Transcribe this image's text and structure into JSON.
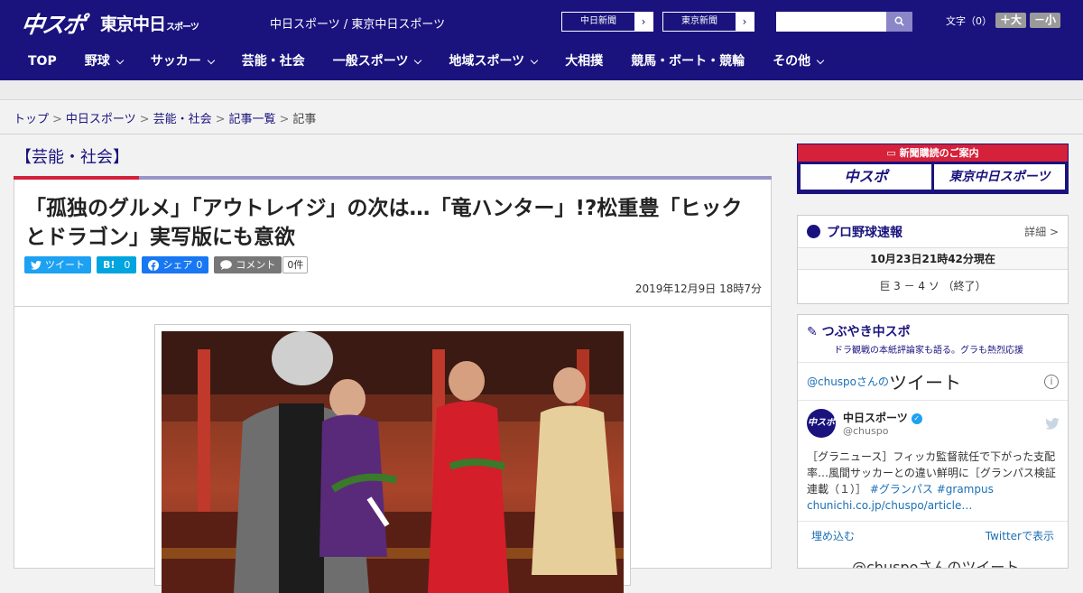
{
  "header": {
    "logo_main": "中スポ",
    "logo_tokyo": "東京中日",
    "logo_tokyo_small": "スポーツ",
    "site_name": "中日スポーツ / 東京中日スポーツ",
    "paper_links": [
      {
        "label": "中日新聞"
      },
      {
        "label": "東京新聞"
      }
    ],
    "arrow": "›",
    "search_placeholder": "",
    "font_size_label": "文字（0）",
    "font_up": "＋大",
    "font_down": "－小"
  },
  "nav": [
    {
      "label": "TOP",
      "dropdown": false
    },
    {
      "label": "野球",
      "dropdown": true
    },
    {
      "label": "サッカー",
      "dropdown": true
    },
    {
      "label": "芸能・社会",
      "dropdown": false
    },
    {
      "label": "一般スポーツ",
      "dropdown": true
    },
    {
      "label": "地域スポーツ",
      "dropdown": true
    },
    {
      "label": "大相撲",
      "dropdown": false
    },
    {
      "label": "競馬・ボート・競輪",
      "dropdown": false
    },
    {
      "label": "その他",
      "dropdown": true
    }
  ],
  "breadcrumb": [
    {
      "label": "トップ"
    },
    {
      "label": "中日スポーツ"
    },
    {
      "label": "芸能・社会"
    },
    {
      "label": "記事一覧"
    },
    {
      "label": "記事"
    }
  ],
  "breadcrumb_sep": ">",
  "article": {
    "category": "【芸能・社会】",
    "headline": "「孤独のグルメ」「アウトレイジ」の次は…「竜ハンター」!?松重豊「ヒックとドラゴン」実写版にも意欲",
    "share": {
      "tweet": "ツイート",
      "hatena": "B!",
      "hatena_count": "0",
      "facebook": "シェア",
      "facebook_count": "0",
      "comment": "コメント",
      "comment_count": "0件"
    },
    "date": "2019年12月9日 18時7分"
  },
  "sidebar": {
    "subscribe": {
      "title": "新聞購読のご案内",
      "left": "中スポ",
      "right": "東京中日スポーツ"
    },
    "baseball": {
      "title": "プロ野球速報",
      "more": "詳細 >",
      "datetime": "10月23日21時42分現在",
      "score": "巨 3 － 4 ソ （終了）"
    },
    "tsubuyaki": {
      "title": "つぶやき中スポ",
      "subtitle": "ドラ観戦の本紙評論家も語る。グラも熱烈応援",
      "tweets_prefix": "@chuspoさんの",
      "tweets_big": "ツイート",
      "info": "i",
      "account_avatar": "中スポ",
      "account_name": "中日スポーツ",
      "verified": "✓",
      "handle": "@chuspo",
      "body_text": "［グラニュース］フィッカ監督就任で下がった支配率…風間サッカーとの違い鮮明に［グランパス検証連載（１）］",
      "body_tags": "#グランパス #grampus",
      "body_link": "chunichi.co.jp/chuspo/article…",
      "embed": "埋め込む",
      "view_on_twitter": "Twitterで表示",
      "more_tweets": "@chuspoさんのツイート"
    }
  },
  "colors": {
    "brand": "#1a137e",
    "accent_red": "#d5213a",
    "twitter": "#1da1f2"
  }
}
